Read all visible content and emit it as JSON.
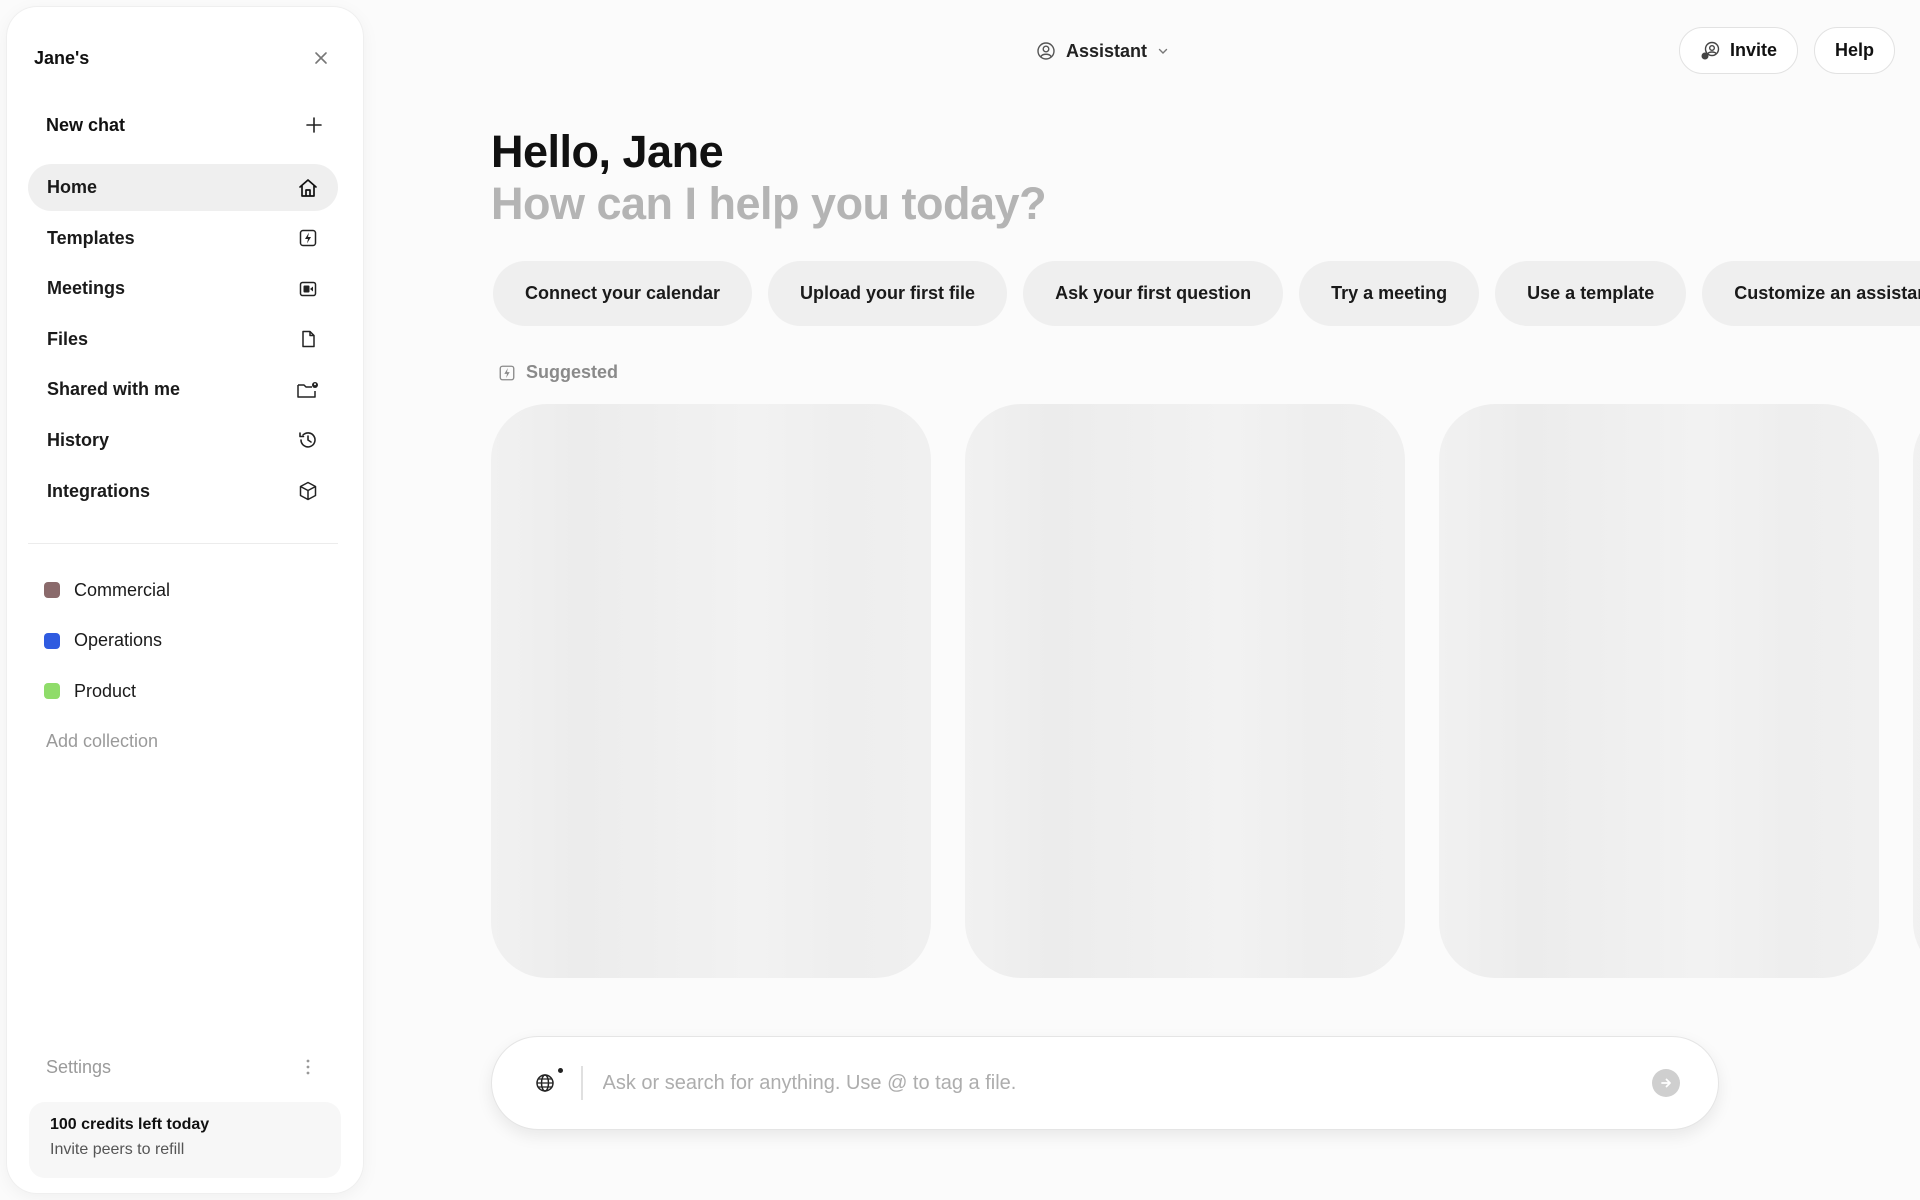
{
  "sidebar": {
    "workspace_name": "Jane's",
    "new_chat_label": "New chat",
    "nav_items": [
      {
        "label": "Home",
        "icon": "home-icon",
        "active": true
      },
      {
        "label": "Templates",
        "icon": "lightning-icon"
      },
      {
        "label": "Meetings",
        "icon": "video-icon"
      },
      {
        "label": "Files",
        "icon": "file-icon"
      },
      {
        "label": "Shared with me",
        "icon": "shared-folder-icon"
      },
      {
        "label": "History",
        "icon": "history-icon"
      },
      {
        "label": "Integrations",
        "icon": "cube-icon"
      }
    ],
    "collections": [
      {
        "label": "Commercial",
        "color": "#8a6a6b"
      },
      {
        "label": "Operations",
        "color": "#2f5be0"
      },
      {
        "label": "Product",
        "color": "#8fdc6a"
      }
    ],
    "add_collection_label": "Add collection",
    "settings_label": "Settings",
    "credits": {
      "title": "100 credits left today",
      "subtitle": "Invite peers to refill"
    }
  },
  "header": {
    "assistant_label": "Assistant",
    "invite_label": "Invite",
    "help_label": "Help"
  },
  "main": {
    "greeting": "Hello, Jane",
    "subtitle": "How can I help you today?",
    "chips": [
      "Connect your calendar",
      "Upload your first file",
      "Ask your first question",
      "Try a meeting",
      "Use a template",
      "Customize an assistant"
    ],
    "suggested_label": "Suggested"
  },
  "composer": {
    "placeholder": "Ask or search for anything. Use @ to tag a file.",
    "value": ""
  }
}
